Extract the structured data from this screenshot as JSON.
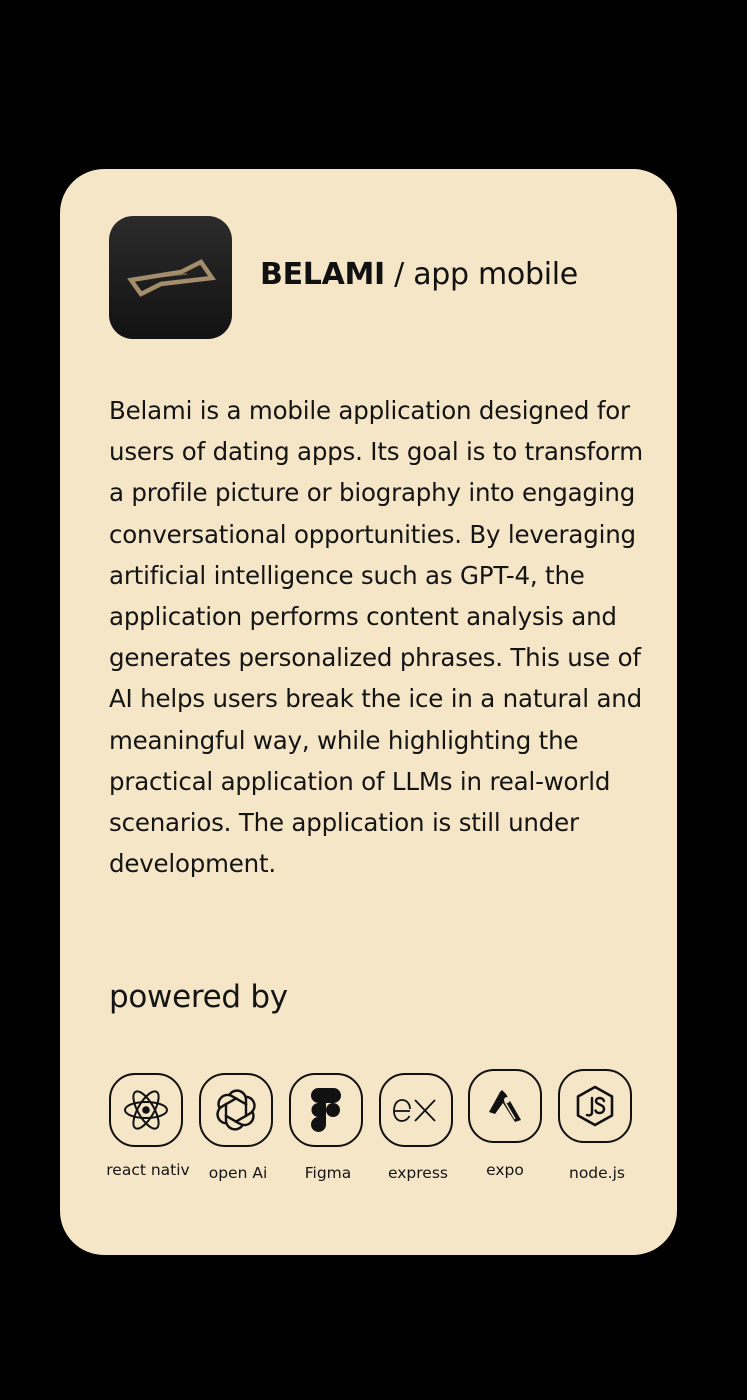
{
  "project": {
    "name": "BELAMI",
    "separator": " / ",
    "subtitle": "app mobile",
    "icon": "belami-logo-icon",
    "description": "Belami is a mobile application designed for users of dating apps. Its goal is to transform a profile picture or biography into engaging conversational opportunities. By leveraging artificial intelligence such as GPT-4, the application performs content analysis and generates personalized phrases. This use of AI helps users break the ice in a natural and meaningful way, while highlighting the practical application of LLMs in real-world scenarios. The application is still under development."
  },
  "powered": {
    "label": "powered by",
    "technologies": [
      {
        "label": "react nativ",
        "icon": "react-icon"
      },
      {
        "label": "open Ai",
        "icon": "openai-icon"
      },
      {
        "label": "Figma",
        "icon": "figma-icon"
      },
      {
        "label": "express",
        "icon": "express-icon"
      },
      {
        "label": "expo",
        "icon": "expo-icon"
      },
      {
        "label": "node.js",
        "icon": "nodejs-icon"
      }
    ]
  },
  "colors": {
    "background": "#000000",
    "card": "#f5e6c8",
    "text": "#111111",
    "logo_gold": "#a48d6a"
  }
}
